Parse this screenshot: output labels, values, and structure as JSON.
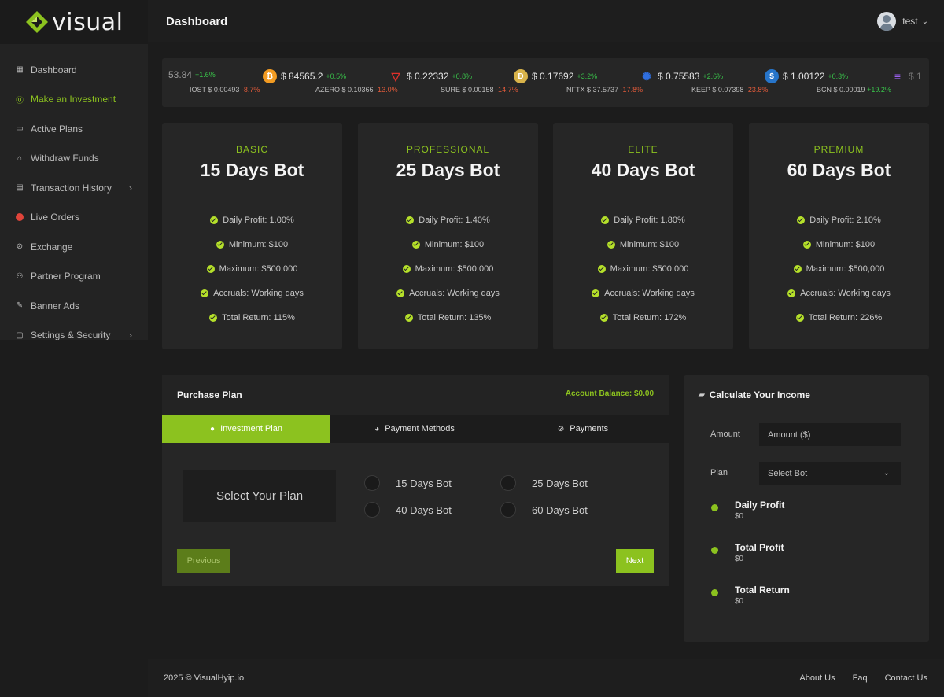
{
  "brand": {
    "name": "visual"
  },
  "header": {
    "title": "Dashboard",
    "user": "test",
    "user_chevron": "⌄"
  },
  "sidebar": {
    "items": [
      {
        "label": "Dashboard",
        "icon": "dashboard-icon"
      },
      {
        "label": "Make an Investment",
        "icon": "investment-icon",
        "active": true
      },
      {
        "label": "Active Plans",
        "icon": "plans-icon"
      },
      {
        "label": "Withdraw Funds",
        "icon": "bank-icon"
      },
      {
        "label": "Transaction History",
        "icon": "calendar-icon",
        "chevron": "›"
      },
      {
        "label": "Live Orders",
        "icon": "live-dot-icon"
      },
      {
        "label": "Exchange",
        "icon": "exchange-icon"
      },
      {
        "label": "Partner Program",
        "icon": "partner-icon"
      },
      {
        "label": "Banner Ads",
        "icon": "banner-icon"
      },
      {
        "label": "Settings & Security",
        "icon": "settings-icon",
        "chevron": "›"
      }
    ]
  },
  "ticker": {
    "top": [
      {
        "price": "53.84",
        "change": "+1.6%"
      },
      {
        "price": "$ 84565.2",
        "change": "+0.5%",
        "icon": "bitcoin-icon"
      },
      {
        "price": "$ 0.22332",
        "change": "+0.8%",
        "icon": "tron-icon"
      },
      {
        "price": "$ 0.17692",
        "change": "+3.2%",
        "icon": "dogecoin-icon"
      },
      {
        "price": "$ 0.75583",
        "change": "+2.6%",
        "icon": "cardano-icon"
      },
      {
        "price": "$ 1.00122",
        "change": "+0.3%",
        "icon": "usdc-icon"
      },
      {
        "price": "$ 1",
        "change": "",
        "icon": "solana-icon"
      }
    ],
    "bottom": [
      {
        "label": "IOST $ 0.00493",
        "change": "-8.7%"
      },
      {
        "label": "AZERO $ 0.10366",
        "change": "-13.0%"
      },
      {
        "label": "SURE $ 0.00158",
        "change": "-14.7%"
      },
      {
        "label": "NFTX $ 37.5737",
        "change": "-17.8%"
      },
      {
        "label": "KEEP $ 0.07398",
        "change": "-23.8%"
      },
      {
        "label": "BCN $ 0.00019",
        "change": "+19.2%"
      }
    ]
  },
  "plans": [
    {
      "tier": "BASIC",
      "title": "15 Days Bot",
      "features": [
        "Daily Profit: 1.00%",
        "Minimum: $100",
        "Maximum: $500,000",
        "Accruals: Working days",
        "Total Return: 115%"
      ]
    },
    {
      "tier": "PROFESSIONAL",
      "title": "25 Days Bot",
      "features": [
        "Daily Profit: 1.40%",
        "Minimum: $100",
        "Maximum: $500,000",
        "Accruals: Working days",
        "Total Return: 135%"
      ]
    },
    {
      "tier": "ELITE",
      "title": "40 Days Bot",
      "features": [
        "Daily Profit: 1.80%",
        "Minimum: $100",
        "Maximum: $500,000",
        "Accruals: Working days",
        "Total Return: 172%"
      ]
    },
    {
      "tier": "PREMIUM",
      "title": "60 Days Bot",
      "features": [
        "Daily Profit: 2.10%",
        "Minimum: $100",
        "Maximum: $500,000",
        "Accruals: Working days",
        "Total Return: 226%"
      ]
    }
  ],
  "purchase": {
    "title": "Purchase Plan",
    "balance": "Account Balance: $0.00",
    "tabs": [
      {
        "label": "Investment Plan",
        "icon": "info-icon"
      },
      {
        "label": "Payment Methods",
        "icon": "pie-icon"
      },
      {
        "label": "Payments",
        "icon": "check-circle-icon"
      }
    ],
    "select_label": "Select Your Plan",
    "options": [
      "15 Days Bot",
      "25 Days Bot",
      "40 Days Bot",
      "60 Days Bot"
    ],
    "prev_label": "Previous",
    "next_label": "Next"
  },
  "calculator": {
    "title": "Calculate Your Income",
    "amount_label": "Amount",
    "amount_placeholder": "Amount ($)",
    "plan_label": "Plan",
    "plan_value": "Select Bot",
    "results": [
      {
        "label": "Daily Profit",
        "value": "$0"
      },
      {
        "label": "Total Profit",
        "value": "$0"
      },
      {
        "label": "Total Return",
        "value": "$0"
      }
    ]
  },
  "footer": {
    "copyright": "2025 © VisualHyip.io",
    "links": [
      "About Us",
      "Faq",
      "Contact Us"
    ]
  },
  "colors": {
    "accent": "#8cc21f",
    "background": "#1c1c1c",
    "card": "#262626",
    "negative": "#e05a3a",
    "positive": "#39c24a"
  }
}
